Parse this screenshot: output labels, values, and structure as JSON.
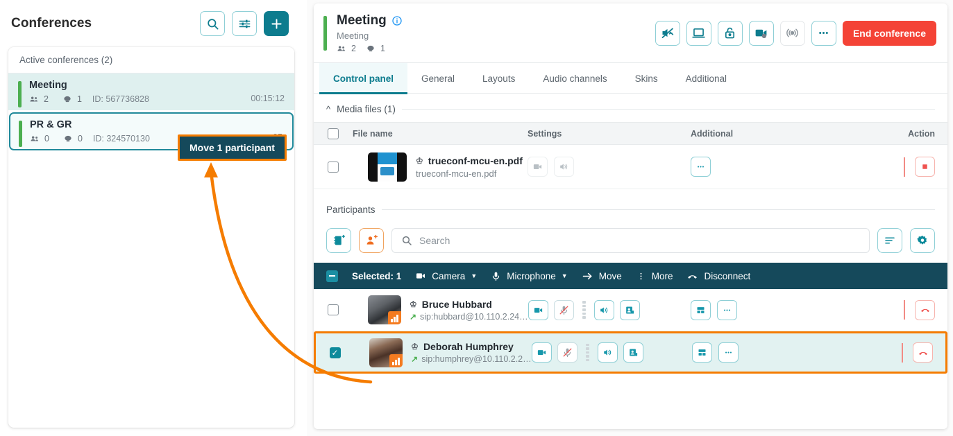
{
  "theme": {
    "accent": "#0d7c8e",
    "accent_light": "#8ecfd6",
    "danger": "#f44336",
    "highlight_orange": "#f57c00",
    "dark_bar": "#15495b",
    "green": "#4caf50",
    "info_blue": "#2196f3"
  },
  "sidebar": {
    "title": "Conferences",
    "buttons": [
      {
        "name": "search",
        "icon": "search-icon"
      },
      {
        "name": "filter",
        "icon": "sliders-icon"
      },
      {
        "name": "add",
        "icon": "plus-icon"
      }
    ],
    "list_header": "Active conferences (2)",
    "conferences": [
      {
        "name": "Meeting",
        "participants": "2",
        "displays": "1",
        "id_label": "ID: 567736828",
        "duration": "00:15:12",
        "selected": false
      },
      {
        "name": "PR & GR",
        "participants": "0",
        "displays": "0",
        "id_label": "ID: 324570130",
        "duration": "05",
        "selected": true
      }
    ]
  },
  "annotation": {
    "tooltip_text": "Move 1 participant"
  },
  "meeting": {
    "title": "Meeting",
    "subtitle": "Meeting",
    "participants": "2",
    "displays": "1",
    "info_icon": "info-icon",
    "actions": [
      {
        "name": "mute-all-button",
        "icon": "mute-all-icon",
        "state": "active"
      },
      {
        "name": "screen-button",
        "icon": "monitor-icon",
        "state": "active"
      },
      {
        "name": "lock-button",
        "icon": "unlock-icon",
        "state": "active"
      },
      {
        "name": "record-button",
        "icon": "video-record-icon",
        "state": "active"
      },
      {
        "name": "broadcast-button",
        "icon": "broadcast-icon",
        "state": "disabled"
      },
      {
        "name": "more-button",
        "icon": "ellipsis-icon",
        "state": "active"
      }
    ],
    "end_label": "End conference",
    "tabs": [
      {
        "label": "Control panel",
        "active": true
      },
      {
        "label": "General",
        "active": false
      },
      {
        "label": "Layouts",
        "active": false
      },
      {
        "label": "Audio channels",
        "active": false
      },
      {
        "label": "Skins",
        "active": false
      },
      {
        "label": "Additional",
        "active": false
      }
    ]
  },
  "media_files": {
    "section_label": "Media files (1)",
    "columns": {
      "file_name": "File name",
      "settings": "Settings",
      "additional": "Additional",
      "action": "Action"
    },
    "rows": [
      {
        "checked": false,
        "name": "trueconf-mcu-en.pdf",
        "sub": "trueconf-mcu-en.pdf",
        "settings_icons": [
          "video-play-icon",
          "speaker-icon"
        ],
        "additional_icon": "ellipsis-icon",
        "action_icon": "stop-icon"
      }
    ]
  },
  "participants": {
    "section_label": "Participants",
    "left_buttons": [
      {
        "name": "address-book-add-button",
        "icon": "address-book-plus-icon"
      },
      {
        "name": "invite-user-button",
        "icon": "user-plus-icon"
      }
    ],
    "search_placeholder": "Search",
    "right_buttons": [
      {
        "name": "sort-button",
        "icon": "sort-icon"
      },
      {
        "name": "settings-button",
        "icon": "gear-icon"
      }
    ],
    "selection_bar": {
      "selected_label": "Selected: 1",
      "actions": [
        {
          "label": "Camera",
          "icon": "camera-icon",
          "caret": true
        },
        {
          "label": "Microphone",
          "icon": "microphone-icon",
          "caret": true
        },
        {
          "label": "Move",
          "icon": "arrow-right-icon",
          "caret": false
        },
        {
          "label": "More",
          "icon": "dots-vertical-icon",
          "caret": false
        },
        {
          "label": "Disconnect",
          "icon": "hangup-icon",
          "caret": false
        }
      ]
    },
    "rows": [
      {
        "checked": false,
        "highlighted": false,
        "name": "Bruce Hubbard",
        "address": "sip:hubbard@10.110.2.24…",
        "icons": [
          "camera-on-icon",
          "microphone-muted-icon",
          "speaker-icon",
          "user-card-icon"
        ],
        "right_icons": [
          "layout-icon",
          "ellipsis-icon"
        ],
        "action_icon": "hangup-icon"
      },
      {
        "checked": true,
        "highlighted": true,
        "name": "Deborah Humphrey",
        "address": "sip:humphrey@10.110.2.2…",
        "icons": [
          "camera-on-icon",
          "microphone-muted-icon",
          "speaker-icon",
          "user-card-icon"
        ],
        "right_icons": [
          "layout-icon",
          "ellipsis-icon"
        ],
        "action_icon": "hangup-icon"
      }
    ]
  }
}
